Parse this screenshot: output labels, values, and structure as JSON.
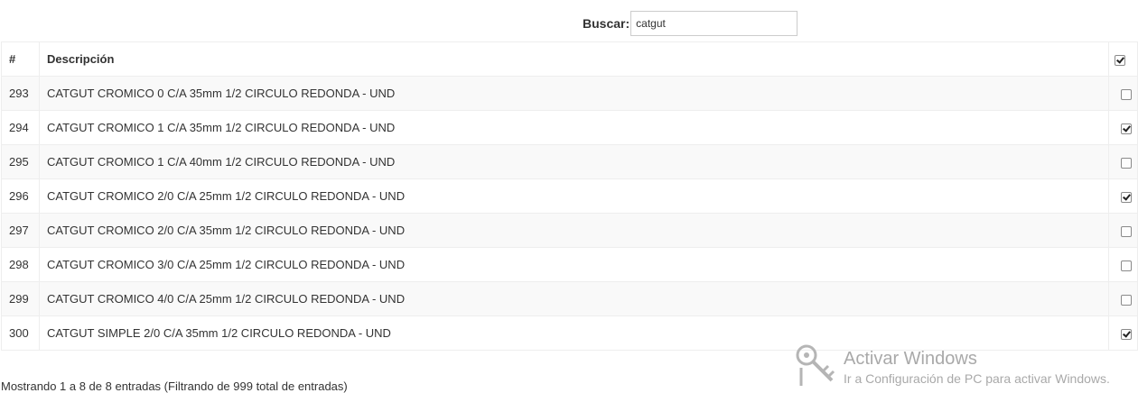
{
  "search": {
    "label": "Buscar:",
    "value": "catgut"
  },
  "table": {
    "headers": {
      "num": "#",
      "description": "Descripción",
      "select_all_checked": true
    },
    "rows": [
      {
        "num": "293",
        "description": "CATGUT CROMICO 0 C/A 35mm 1/2 CIRCULO REDONDA - UND",
        "checked": false
      },
      {
        "num": "294",
        "description": "CATGUT CROMICO 1 C/A 35mm 1/2 CIRCULO REDONDA - UND",
        "checked": true
      },
      {
        "num": "295",
        "description": "CATGUT CROMICO 1 C/A 40mm 1/2 CIRCULO REDONDA - UND",
        "checked": false
      },
      {
        "num": "296",
        "description": "CATGUT CROMICO 2/0 C/A 25mm 1/2 CIRCULO REDONDA - UND",
        "checked": true
      },
      {
        "num": "297",
        "description": "CATGUT CROMICO 2/0 C/A 35mm 1/2 CIRCULO REDONDA - UND",
        "checked": false
      },
      {
        "num": "298",
        "description": "CATGUT CROMICO 3/0 C/A 25mm 1/2 CIRCULO REDONDA - UND",
        "checked": false
      },
      {
        "num": "299",
        "description": "CATGUT CROMICO 4/0 C/A 25mm 1/2 CIRCULO REDONDA - UND",
        "checked": false
      },
      {
        "num": "300",
        "description": "CATGUT SIMPLE 2/0 C/A 35mm 1/2 CIRCULO REDONDA - UND",
        "checked": true
      }
    ]
  },
  "footer": {
    "info": "Mostrando 1 a 8 de 8 entradas (Filtrando de 999 total de entradas)"
  },
  "watermark": {
    "title": "Activar Windows",
    "subtitle": "Ir a Configuración de PC para activar Windows.",
    "icon": "key-icon"
  }
}
